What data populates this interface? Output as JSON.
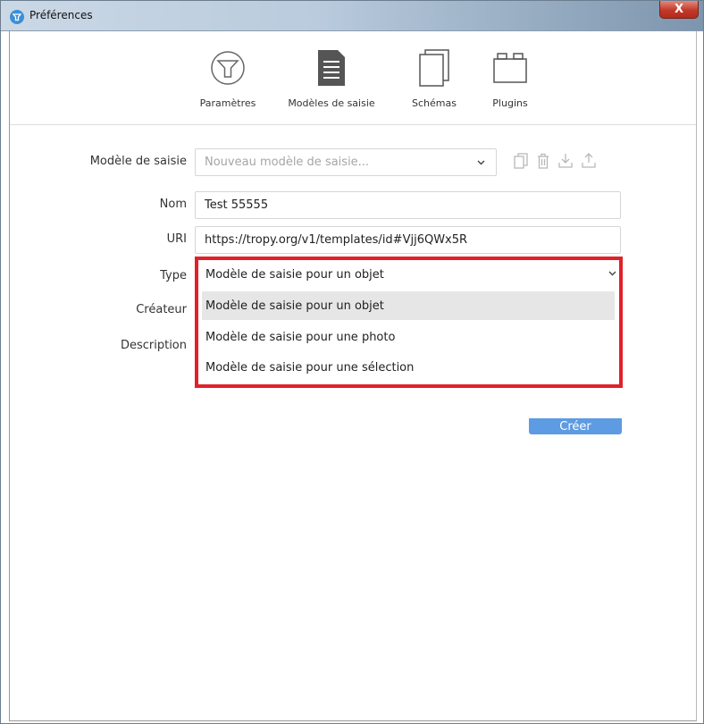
{
  "window": {
    "title": "Préférences",
    "close_label": "X"
  },
  "toolbar": {
    "items": [
      {
        "label": "Paramètres",
        "icon": "tropy-logo-icon"
      },
      {
        "label": "Modèles de saisie",
        "icon": "document-icon"
      },
      {
        "label": "Schémas",
        "icon": "vocabulary-icon"
      },
      {
        "label": "Plugins",
        "icon": "plugin-icon"
      }
    ]
  },
  "form": {
    "template_label": "Modèle de saisie",
    "template_placeholder": "Nouveau modèle de saisie...",
    "name_label": "Nom",
    "name_value": "Test 55555",
    "uri_label": "URI",
    "uri_value": "https://tropy.org/v1/templates/id#Vjj6QWx5R",
    "type_label": "Type",
    "type_value": "Modèle de saisie pour un objet",
    "creator_label": "Créateur",
    "description_label": "Description",
    "create_button": "Créer"
  },
  "dropdown": {
    "options": [
      "Modèle de saisie pour un objet",
      "Modèle de saisie pour une photo",
      "Modèle de saisie pour une sélection"
    ],
    "selected_index": 0
  },
  "colors": {
    "highlight_border": "#e0212b",
    "button_blue": "#5d9be3",
    "accent": "#3d8fd6"
  }
}
